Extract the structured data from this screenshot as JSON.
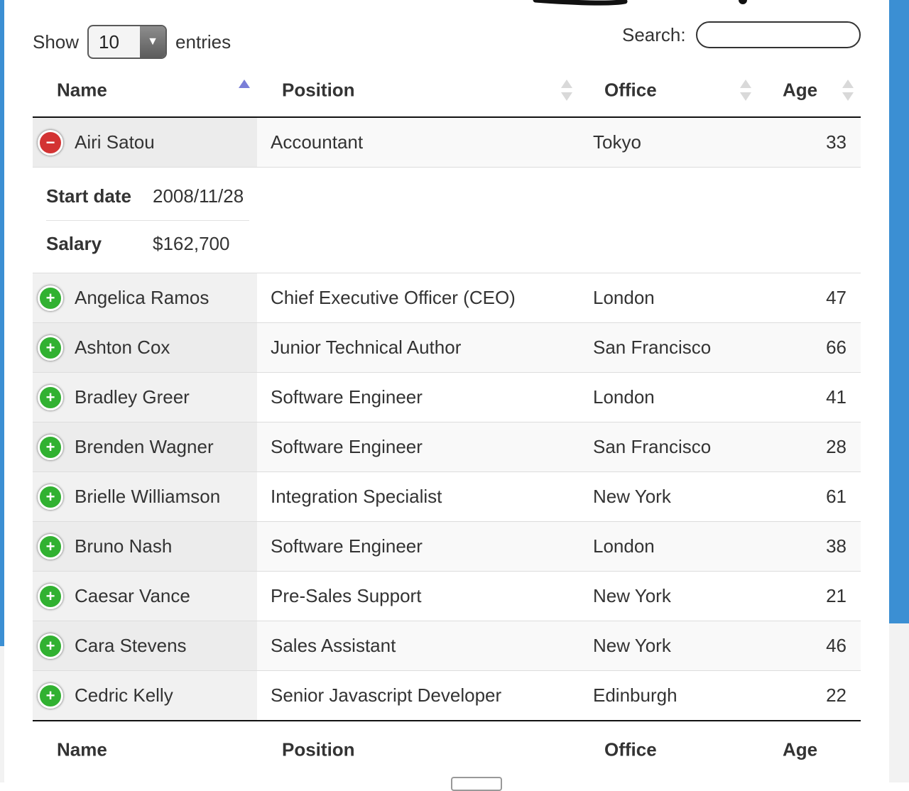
{
  "length_control": {
    "show_label": "Show",
    "value": "10",
    "entries_label": "entries"
  },
  "search": {
    "label": "Search:",
    "value": ""
  },
  "columns": {
    "name": "Name",
    "position": "Position",
    "office": "Office",
    "age": "Age"
  },
  "rows": [
    {
      "name": "Airi Satou",
      "position": "Accountant",
      "office": "Tokyo",
      "age": "33",
      "expanded": true,
      "details": [
        {
          "label": "Start date",
          "value": "2008/11/28"
        },
        {
          "label": "Salary",
          "value": "$162,700"
        }
      ]
    },
    {
      "name": "Angelica Ramos",
      "position": "Chief Executive Officer (CEO)",
      "office": "London",
      "age": "47"
    },
    {
      "name": "Ashton Cox",
      "position": "Junior Technical Author",
      "office": "San Francisco",
      "age": "66"
    },
    {
      "name": "Bradley Greer",
      "position": "Software Engineer",
      "office": "London",
      "age": "41"
    },
    {
      "name": "Brenden Wagner",
      "position": "Software Engineer",
      "office": "San Francisco",
      "age": "28"
    },
    {
      "name": "Brielle Williamson",
      "position": "Integration Specialist",
      "office": "New York",
      "age": "61"
    },
    {
      "name": "Bruno Nash",
      "position": "Software Engineer",
      "office": "London",
      "age": "38"
    },
    {
      "name": "Caesar Vance",
      "position": "Pre-Sales Support",
      "office": "New York",
      "age": "21"
    },
    {
      "name": "Cara Stevens",
      "position": "Sales Assistant",
      "office": "New York",
      "age": "46"
    },
    {
      "name": "Cedric Kelly",
      "position": "Senior Javascript Developer",
      "office": "Edinburgh",
      "age": "22"
    }
  ],
  "sort": {
    "column": "name",
    "direction": "ascending"
  },
  "colors": {
    "sidebar_blue": "#3b8fd3",
    "expand_green": "#31b131",
    "collapse_red": "#d33333",
    "sort_active": "#7a7ed8"
  },
  "icons": {
    "expand": "plus-circle-icon",
    "collapse": "minus-circle-icon",
    "sort": "sort-arrows-icon",
    "dropdown": "caret-down-icon"
  }
}
